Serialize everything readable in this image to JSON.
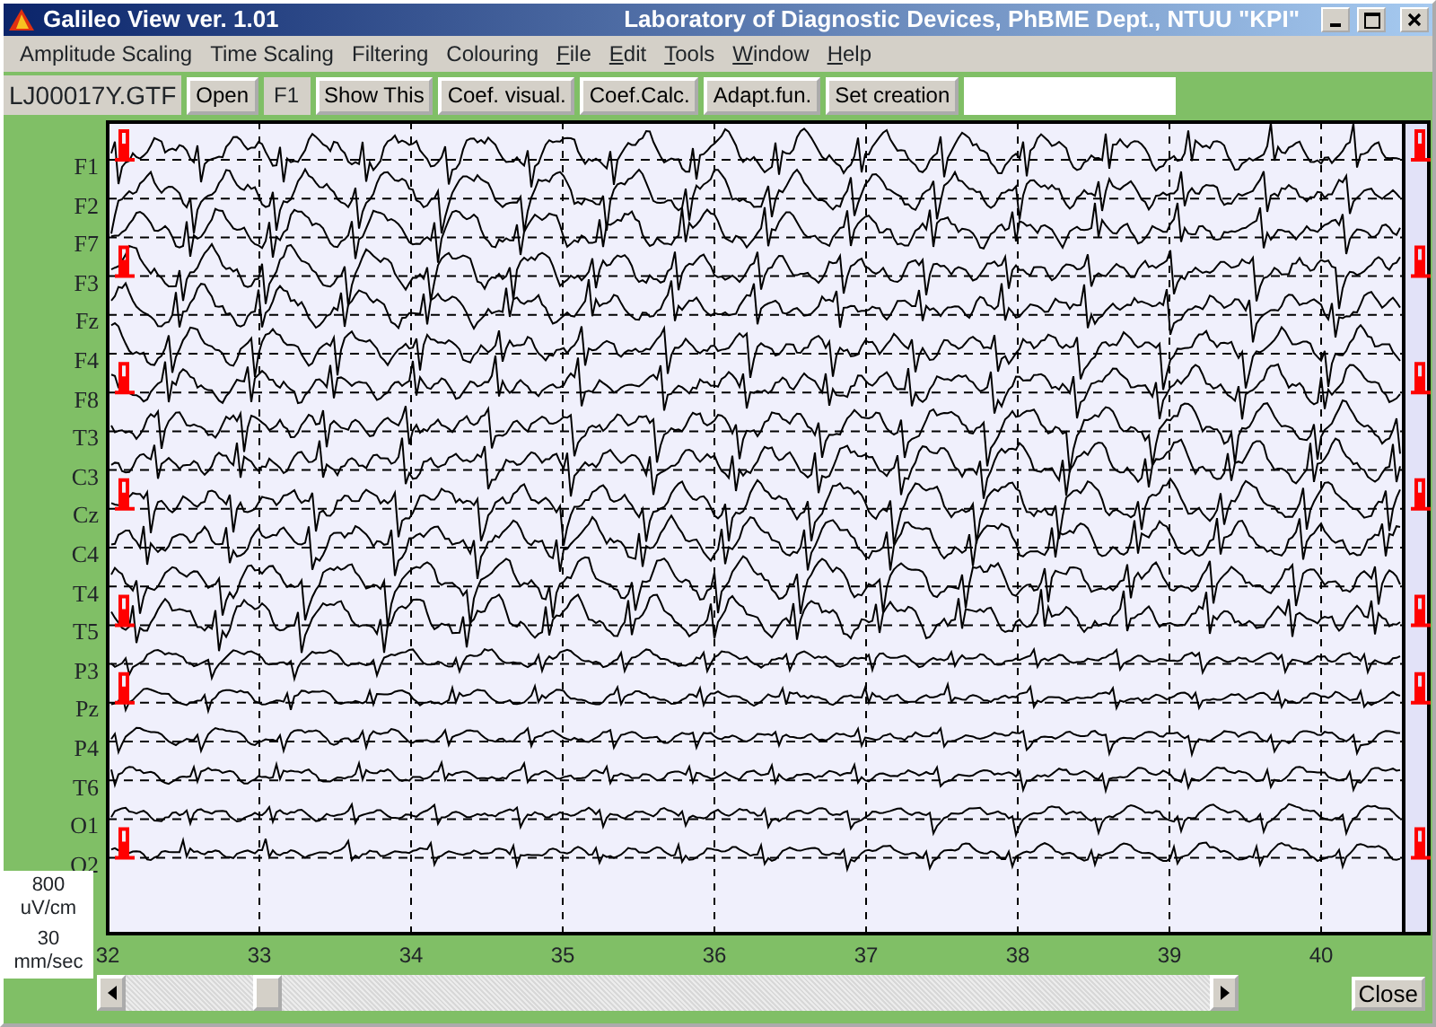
{
  "window": {
    "title": "Galileo View ver. 1.01",
    "subtitle": "Laboratory of Diagnostic Devices, PhBME Dept., NTUU \"KPI\""
  },
  "menu": [
    {
      "label": "Amplitude Scaling",
      "underline_first": false
    },
    {
      "label": "Time Scaling",
      "underline_first": false
    },
    {
      "label": "Filtering",
      "underline_first": false
    },
    {
      "label": "Colouring",
      "underline_first": false
    },
    {
      "label": "File",
      "underline_first": true
    },
    {
      "label": "Edit",
      "underline_first": true
    },
    {
      "label": "Tools",
      "underline_first": true
    },
    {
      "label": "Window",
      "underline_first": true
    },
    {
      "label": "Help",
      "underline_first": true
    }
  ],
  "toolbar": {
    "file_name": "LJ00017Y.GTF",
    "buttons": [
      {
        "label": "Open",
        "kind": "button"
      },
      {
        "label": "F1",
        "kind": "tag"
      },
      {
        "label": "Show This",
        "kind": "button"
      },
      {
        "label": "Coef. visual.",
        "kind": "button"
      },
      {
        "label": "Coef.Calc.",
        "kind": "button"
      },
      {
        "label": "Adapt.fun.",
        "kind": "button"
      },
      {
        "label": "Set creation",
        "kind": "button"
      }
    ]
  },
  "channels": [
    {
      "name": "F1",
      "marker": true
    },
    {
      "name": "F2",
      "marker": false
    },
    {
      "name": "F7",
      "marker": false
    },
    {
      "name": "F3",
      "marker": true
    },
    {
      "name": "Fz",
      "marker": false
    },
    {
      "name": "F4",
      "marker": false
    },
    {
      "name": "F8",
      "marker": true
    },
    {
      "name": "T3",
      "marker": false
    },
    {
      "name": "C3",
      "marker": false
    },
    {
      "name": "Cz",
      "marker": true
    },
    {
      "name": "C4",
      "marker": false
    },
    {
      "name": "T4",
      "marker": false
    },
    {
      "name": "T5",
      "marker": true
    },
    {
      "name": "P3",
      "marker": false
    },
    {
      "name": "Pz",
      "marker": true
    },
    {
      "name": "P4",
      "marker": false
    },
    {
      "name": "T6",
      "marker": false
    },
    {
      "name": "O1",
      "marker": false
    },
    {
      "name": "O2",
      "marker": true
    }
  ],
  "scale": {
    "amplitude": "800",
    "amplitude_unit": "uV/cm",
    "speed": "30",
    "speed_unit": "mm/sec"
  },
  "time_axis": [
    "32",
    "33",
    "34",
    "35",
    "36",
    "37",
    "38",
    "39",
    "40"
  ],
  "scrollbar": {
    "level": 0.13
  },
  "close_button": "Close"
}
